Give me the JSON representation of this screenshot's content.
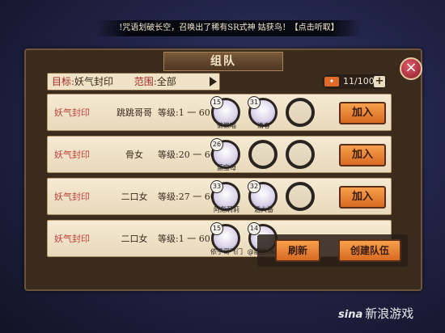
{
  "banner": {
    "text": "!咒语划破长空，召唤出了稀有SR式神 姑获鸟！【点击听取】"
  },
  "window": {
    "title": "组队",
    "close_icon": "close-icon"
  },
  "filter": {
    "goal_label": "目标:",
    "goal_value": "妖气封印",
    "scope_label": "范围:",
    "scope_value": "全部",
    "arrow_icon": "play-triangle-icon"
  },
  "tickets": {
    "icon": "ticket-icon",
    "count": "11/100",
    "plus": "+"
  },
  "rows": [
    {
      "goal": "妖气封印",
      "leader": "跳跳哥哥",
      "level": "等级:1 一 60",
      "join": "加入",
      "members": [
        {
          "level": "15",
          "name": "懒懒喵"
        },
        {
          "level": "31",
          "name": "清春"
        }
      ]
    },
    {
      "goal": "妖气封印",
      "leader": "骨女",
      "level": "等级:20 一 60",
      "join": "加入",
      "members": [
        {
          "level": "26",
          "name": "蓝宝母"
        }
      ]
    },
    {
      "goal": "妖气封印",
      "leader": "二口女",
      "level": "等级:27 一 60",
      "join": "加入",
      "members": [
        {
          "level": "33",
          "name": "阿彪莉莉"
        },
        {
          "level": "32",
          "name": "涵大番"
        }
      ]
    },
    {
      "goal": "妖气封印",
      "leader": "二口女",
      "level": "等级:1 一 60",
      "join": "加入",
      "members": [
        {
          "level": "15",
          "name": "依子哥飞门"
        },
        {
          "level": "14",
          "name": "@晨迪sam"
        }
      ]
    }
  ],
  "actions": {
    "refresh": "刷新",
    "create_team": "创建队伍"
  },
  "watermark": {
    "brand": "sina",
    "text": "新浪游戏"
  },
  "colors": {
    "accent_orange": "#e8852f",
    "frame_brown": "#3b2b1c",
    "goal_red": "#c0423b"
  }
}
